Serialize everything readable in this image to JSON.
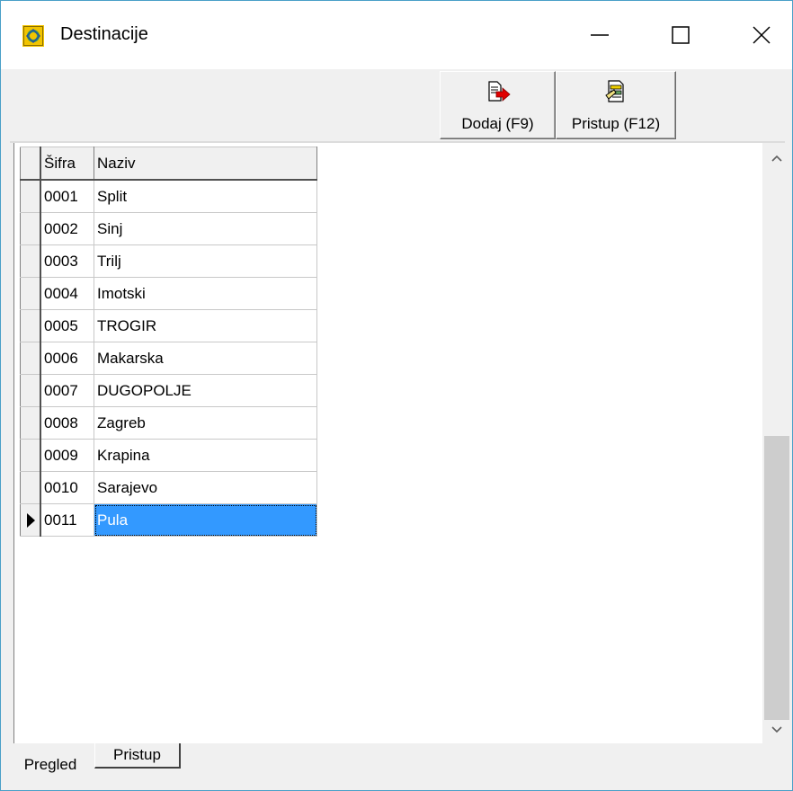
{
  "window": {
    "title": "Destinacije",
    "app_icon": "app-logo-icon",
    "controls": [
      "minimize-icon",
      "maximize-icon",
      "close-icon"
    ]
  },
  "toolbar": {
    "add_label": "Dodaj (F9)",
    "add_icon": "add-record-arrow-icon",
    "access_label": "Pristup (F12)",
    "access_icon": "access-document-icon"
  },
  "grid": {
    "columns": [
      "Šifra",
      "Naziv"
    ],
    "rows": [
      {
        "code": "0001",
        "name": "Split"
      },
      {
        "code": "0002",
        "name": "Sinj"
      },
      {
        "code": "0003",
        "name": "Trilj"
      },
      {
        "code": "0004",
        "name": "Imotski"
      },
      {
        "code": "0005",
        "name": "TROGIR"
      },
      {
        "code": "0006",
        "name": "Makarska"
      },
      {
        "code": "0007",
        "name": "DUGOPOLJE"
      },
      {
        "code": "0008",
        "name": "Zagreb"
      },
      {
        "code": "0009",
        "name": "Krapina"
      },
      {
        "code": "0010",
        "name": "Sarajevo"
      },
      {
        "code": "0011",
        "name": "Pula"
      }
    ],
    "selected_row": 10
  },
  "tabs": [
    {
      "label": "Pregled",
      "active": true
    },
    {
      "label": "Pristup",
      "active": false
    }
  ],
  "colors": {
    "selection": "#3399ff",
    "window_border": "#4aa0c8"
  }
}
